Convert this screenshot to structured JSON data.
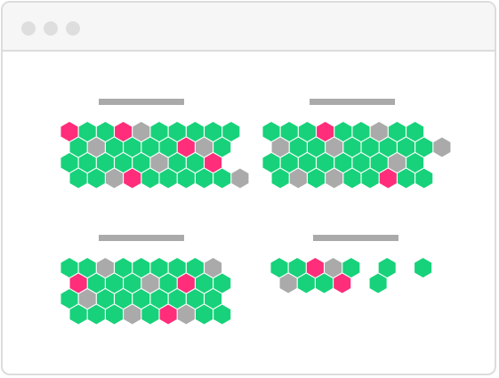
{
  "window": {
    "controls": [
      "window-dot",
      "window-dot",
      "window-dot"
    ]
  },
  "colors": {
    "active": "#17d27a",
    "alert": "#ff2d7a",
    "inactive": "#aaaaaa",
    "title_placeholder": "#aaaaaa"
  },
  "panels": [
    {
      "name": "panel-top-left",
      "rows": [
        [
          "a",
          "g",
          "g",
          "a",
          "i",
          "g",
          "g",
          "g",
          "g",
          "g"
        ],
        [
          "g",
          "i",
          "g",
          "g",
          "g",
          "g",
          "a",
          "i",
          "g"
        ],
        [
          "g",
          "g",
          "g",
          "g",
          "g",
          "i",
          "g",
          "g",
          "a"
        ],
        [
          "g",
          "g",
          "i",
          "a",
          "g",
          "g",
          "g",
          "g",
          "g",
          "i"
        ]
      ]
    },
    {
      "name": "panel-top-right",
      "rows": [
        [
          "g",
          "g",
          "g",
          "a",
          "g",
          "g",
          "i",
          "g",
          "g"
        ],
        [
          "i",
          "g",
          "g",
          "i",
          "g",
          "g",
          "g",
          "g",
          "g",
          "i"
        ],
        [
          "g",
          "g",
          "g",
          "g",
          "g",
          "g",
          "g",
          "i",
          "g"
        ],
        [
          "g",
          "i",
          "g",
          "i",
          "g",
          "g",
          "a",
          "g",
          "g"
        ]
      ]
    },
    {
      "name": "panel-bottom-left",
      "rows": [
        [
          "g",
          "g",
          "i",
          "g",
          "g",
          "g",
          "g",
          "g",
          "i"
        ],
        [
          "a",
          "g",
          "g",
          "g",
          "i",
          "g",
          "a",
          "g",
          "g"
        ],
        [
          "g",
          "i",
          "g",
          "g",
          "g",
          "g",
          "g",
          "g",
          "g"
        ],
        [
          "g",
          "g",
          "g",
          "i",
          "g",
          "a",
          "i",
          "g",
          "g"
        ]
      ]
    },
    {
      "name": "panel-bottom-right",
      "rows": [
        [
          "g",
          "g",
          "a",
          "i",
          "g",
          "_",
          "g",
          "_",
          "g"
        ],
        [
          "i",
          "g",
          "g",
          "a",
          "_",
          "g"
        ]
      ]
    }
  ]
}
